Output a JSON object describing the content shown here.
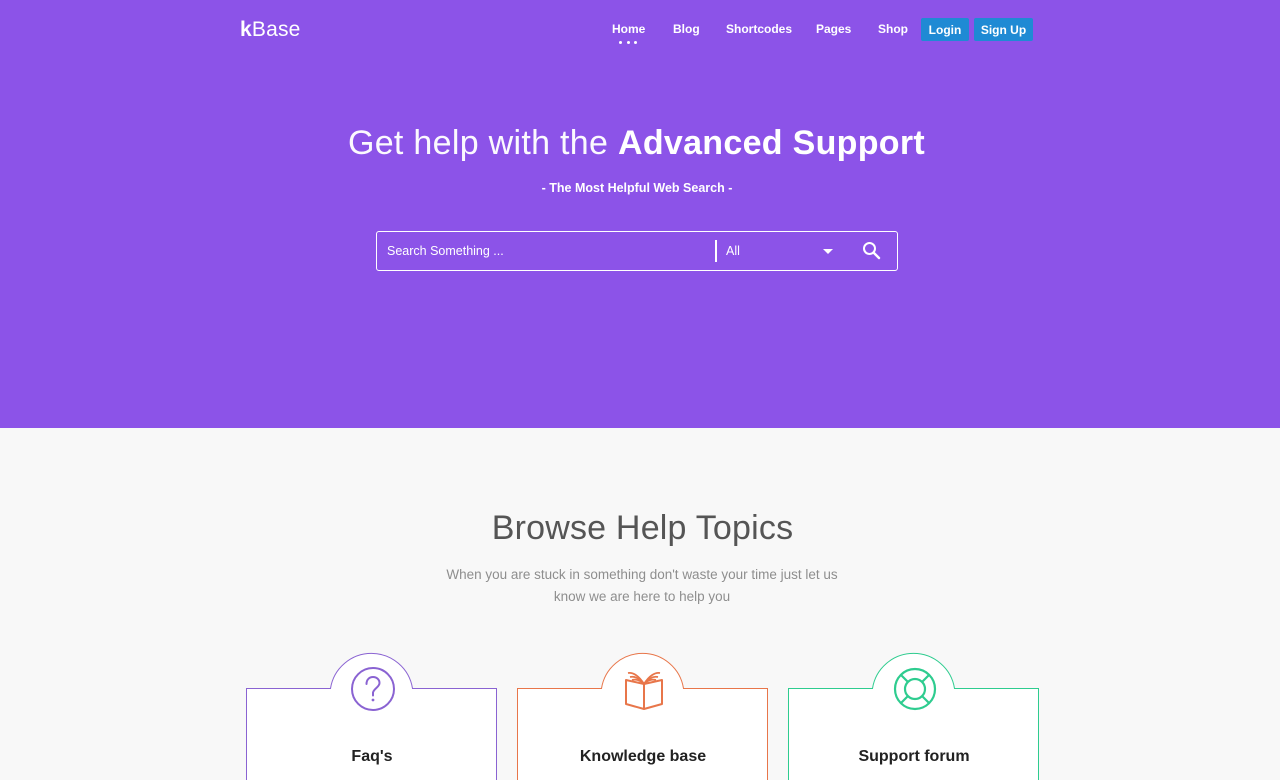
{
  "header": {
    "logo_bold": "k",
    "logo_rest": "Base",
    "nav": [
      {
        "label": "Home",
        "active": true
      },
      {
        "label": "Blog"
      },
      {
        "label": "Shortcodes"
      },
      {
        "label": "Pages"
      },
      {
        "label": "Shop"
      }
    ],
    "login_label": "Login",
    "signup_label": "Sign Up"
  },
  "hero": {
    "title_light": "Get help with the ",
    "title_bold": "Advanced Support",
    "subtitle": "-  The Most Helpful Web Search  -",
    "search": {
      "placeholder": "Search Something ...",
      "value": "",
      "category_selected": "All",
      "search_icon": "search-icon",
      "dropdown_icon": "caret-down-icon"
    }
  },
  "browse": {
    "title": "Browse Help Topics",
    "description": "When you are stuck in something don't waste your time just let us know we are here to help you",
    "cards": [
      {
        "label": "Faq's",
        "icon": "question-circle-icon",
        "color": "#8a63d2"
      },
      {
        "label": "Knowledge base",
        "icon": "open-book-icon",
        "color": "#e8764a"
      },
      {
        "label": "Support forum",
        "icon": "lifebuoy-icon",
        "color": "#2ecc8f"
      }
    ]
  },
  "colors": {
    "hero_bg": "#8c53e8",
    "button_bg": "#1f8ad4",
    "page_bg": "#f8f8f8"
  }
}
